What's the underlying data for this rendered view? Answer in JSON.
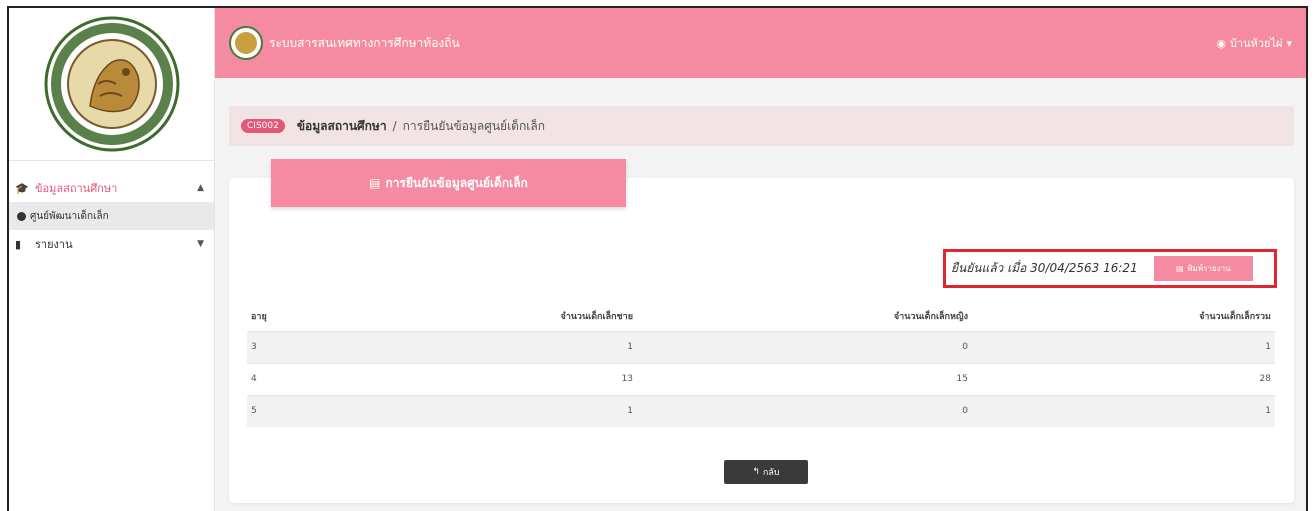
{
  "header": {
    "app_title": "ระบบสารสนเทศทางการศึกษาท้องถิ่น",
    "user_name": "บ้านห้วยไผ่",
    "user_icon": "user-circle-icon",
    "colors": {
      "primary": "#f58ba3",
      "accent": "#e2587a",
      "highlight_border": "#e0262f",
      "dark_button": "#3a3a3a"
    }
  },
  "sidebar": {
    "menu": [
      {
        "label": "ข้อมูลสถานศึกษา",
        "icon": "graduation-cap-icon",
        "expanded": true
      },
      {
        "label": "รายงาน",
        "icon": "file-icon",
        "expanded": false
      }
    ],
    "submenu": [
      {
        "label": "ศูนย์พัฒนาเด็กเล็ก"
      }
    ]
  },
  "breadcrumb": {
    "code": "CIS002",
    "section": "ข้อมูลสถานศึกษา",
    "separator": "/",
    "current": "การยืนยันข้อมูลศูนย์เด็กเล็ก"
  },
  "card": {
    "title": "การยืนยันข้อมูลศูนย์เด็กเล็ก",
    "confirm_text": "ยืนยันแล้ว เมื่อ 30/04/2563 16:21",
    "print_label": "พิมพ์รายงาน",
    "back_label": "กลับ"
  },
  "table": {
    "headers": [
      "อายุ",
      "จำนวนเด็กเล็กชาย",
      "จำนวนเด็กเล็กหญิง",
      "จำนวนเด็กเล็กรวม"
    ],
    "rows": [
      [
        "3",
        "1",
        "0",
        "1"
      ],
      [
        "4",
        "13",
        "15",
        "28"
      ],
      [
        "5",
        "1",
        "0",
        "1"
      ]
    ]
  }
}
